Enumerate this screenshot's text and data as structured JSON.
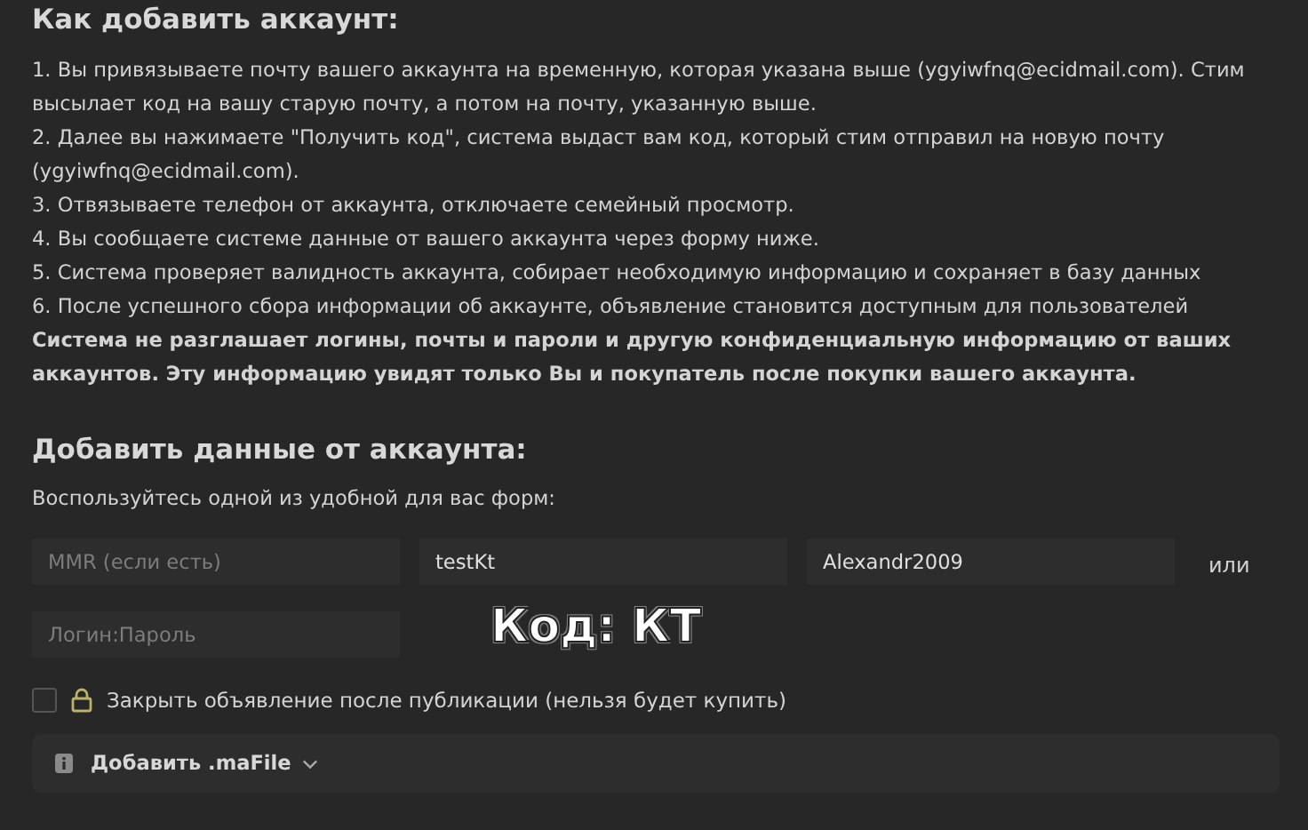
{
  "instructions": {
    "title": "Как добавить аккаунт:",
    "steps": [
      "1. Вы привязываете почту вашего аккаунта на временную, которая указана выше (ygyiwfnq@ecidmail.com). Стим высылает код на вашу старую почту, а потом на почту, указанную выше.",
      "2. Далее вы нажимаете \"Получить код\", система выдаст вам код, который стим отправил на новую почту (ygyiwfnq@ecidmail.com).",
      "3. Отвязываете телефон от аккаунта, отключаете семейный просмотр.",
      "4. Вы сообщаете системе данные от вашего аккаунта через форму ниже.",
      "5. Система проверяет валидность аккаунта, собирает необходимую информацию и сохраняет в базу данных",
      "6. После успешного сбора информации об аккаунте, объявление становится доступным для пользователей"
    ],
    "notice": "Система не разглашает логины, почты и пароли и другую конфиденциальную информацию от ваших аккаунтов. Эту информацию увидят только Вы и покупатель после покупки вашего аккаунта."
  },
  "form": {
    "title": "Добавить данные от аккаунта:",
    "hint": "Воспользуйтесь одной из удобной для вас форм:",
    "fields": [
      {
        "placeholder": "MMR (если есть)"
      },
      {
        "value": "testKt"
      },
      {
        "value": "Alexandr2009"
      }
    ],
    "or_label": "или",
    "login_field": {
      "placeholder": "Логин:Пароль"
    },
    "close_listing": {
      "label": "Закрыть объявление после публикации (нельзя будет купить)",
      "checked": false
    },
    "mafile_button": "Добавить .maFile"
  },
  "overlay_caption": "Код: КТ"
}
